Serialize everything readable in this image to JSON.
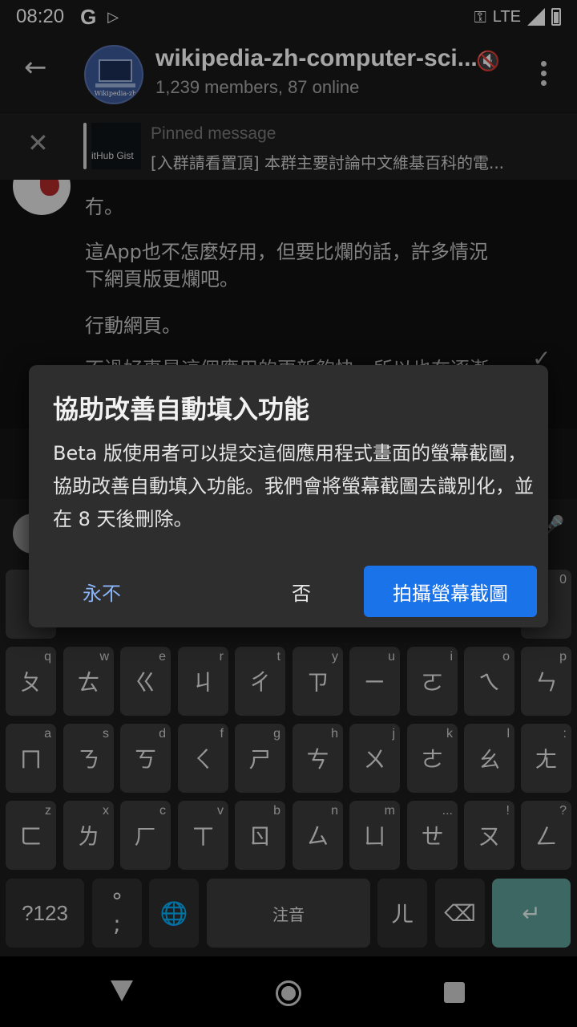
{
  "status_bar": {
    "time": "08:20",
    "network": "LTE"
  },
  "header": {
    "back_icon": "arrow-left-icon",
    "group_title": "wikipedia-zh-computer-sci...",
    "member_info": "1,239 members, 87 online",
    "avatar_text": "Wikipedia-zh"
  },
  "pinned": {
    "label": "Pinned message",
    "text": "[入群請看置頂] 本群主要討論中文維基百科的電...",
    "thumb_text": "itHub Gist"
  },
  "chat": {
    "lines": [
      "冇。",
      "這App也不怎麼好用，但要比爛的話，許多情況",
      "下網頁版更爛吧。",
      "行動網頁。",
      "不過好事是這個應用的更新夠快，所以也在逐漸"
    ]
  },
  "dialog": {
    "title": "協助改善自動填入功能",
    "body": "Beta 版使用者可以提交這個應用程式畫面的螢幕截圖，協助改善自動填入功能。我們會將螢幕截圖去識別化，並在 8 天後刪除。",
    "never_label": "永不",
    "no_label": "否",
    "yes_label": "拍攝螢幕截圖"
  },
  "keyboard": {
    "row0_hint_left": "",
    "row0_hint_right": "0",
    "row1": [
      {
        "key": "ㄆ",
        "hint": "q"
      },
      {
        "key": "ㄊ",
        "hint": "w"
      },
      {
        "key": "ㄍ",
        "hint": "e"
      },
      {
        "key": "ㄐ",
        "hint": "r"
      },
      {
        "key": "ㄔ",
        "hint": "t"
      },
      {
        "key": "ㄗ",
        "hint": "y"
      },
      {
        "key": "ㄧ",
        "hint": "u"
      },
      {
        "key": "ㄛ",
        "hint": "i"
      },
      {
        "key": "ㄟ",
        "hint": "o"
      },
      {
        "key": "ㄣ",
        "hint": "p"
      }
    ],
    "row2": [
      {
        "key": "ㄇ",
        "hint": "a"
      },
      {
        "key": "ㄋ",
        "hint": "s"
      },
      {
        "key": "ㄎ",
        "hint": "d"
      },
      {
        "key": "ㄑ",
        "hint": "f"
      },
      {
        "key": "ㄕ",
        "hint": "g"
      },
      {
        "key": "ㄘ",
        "hint": "h"
      },
      {
        "key": "ㄨ",
        "hint": "j"
      },
      {
        "key": "ㄜ",
        "hint": "k"
      },
      {
        "key": "ㄠ",
        "hint": "l"
      },
      {
        "key": "ㄤ",
        "hint": ":"
      }
    ],
    "row3": [
      {
        "key": "ㄈ",
        "hint": "z"
      },
      {
        "key": "ㄌ",
        "hint": "x"
      },
      {
        "key": "ㄏ",
        "hint": "c"
      },
      {
        "key": "ㄒ",
        "hint": "v"
      },
      {
        "key": "ㄖ",
        "hint": "b"
      },
      {
        "key": "ㄙ",
        "hint": "n"
      },
      {
        "key": "ㄩ",
        "hint": "m"
      },
      {
        "key": "ㄝ",
        "hint": "..."
      },
      {
        "key": "ㄡ",
        "hint": "!"
      },
      {
        "key": "ㄥ",
        "hint": "?"
      }
    ],
    "symbols_label": "?123",
    "punct_top": "°",
    "punct_bottom": ";",
    "globe_icon": "globe-icon",
    "space_label": "注音",
    "er_key": "ㄦ",
    "backspace_icon": "backspace-icon",
    "enter_icon": "enter-arrow-icon"
  },
  "navbar": {
    "back_icon": "nav-back-icon",
    "home_icon": "nav-home-icon",
    "recent_icon": "nav-recent-icon"
  }
}
